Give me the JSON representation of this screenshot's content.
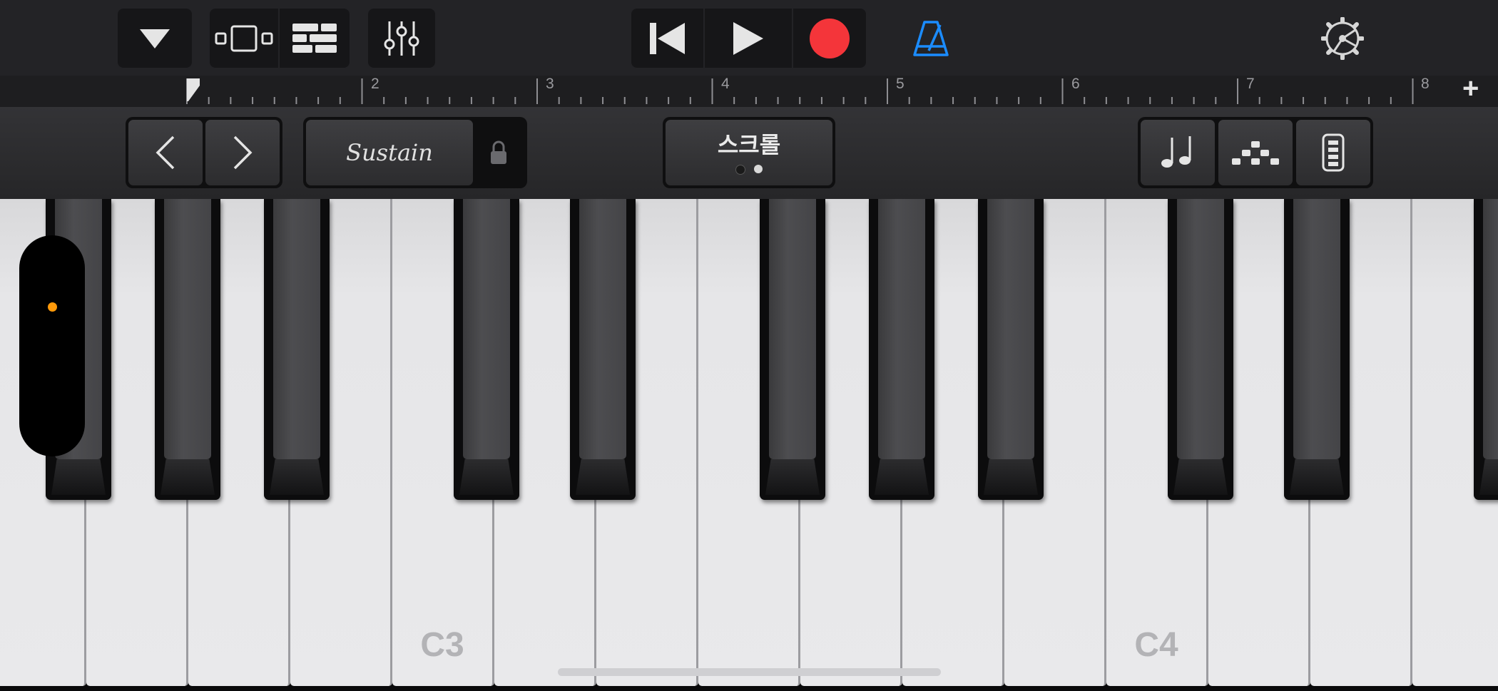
{
  "ruler": {
    "bar_numbers": [
      "2",
      "3",
      "4",
      "5",
      "6",
      "7",
      "8"
    ],
    "add_label": "+"
  },
  "controls": {
    "sustain_label": "Sustain",
    "scroll_label": "스크롤"
  },
  "keyboard": {
    "octave_labels": [
      "C3",
      "C4"
    ]
  },
  "colors": {
    "record": "#f4353a",
    "metronome": "#1b8cff",
    "modwheel_dot": "#ff9a0a",
    "ui_background": "#232326"
  },
  "icons": [
    "dropdown-icon",
    "smart-controls-icon",
    "tracks-view-icon",
    "mixer-icon",
    "go-to-beginning-icon",
    "play-icon",
    "record-icon",
    "metronome-icon",
    "settings-gear-icon",
    "chevron-left-icon",
    "chevron-right-icon",
    "lock-icon",
    "notes-icon",
    "arpeggiator-icon",
    "keyboard-layout-icon"
  ]
}
